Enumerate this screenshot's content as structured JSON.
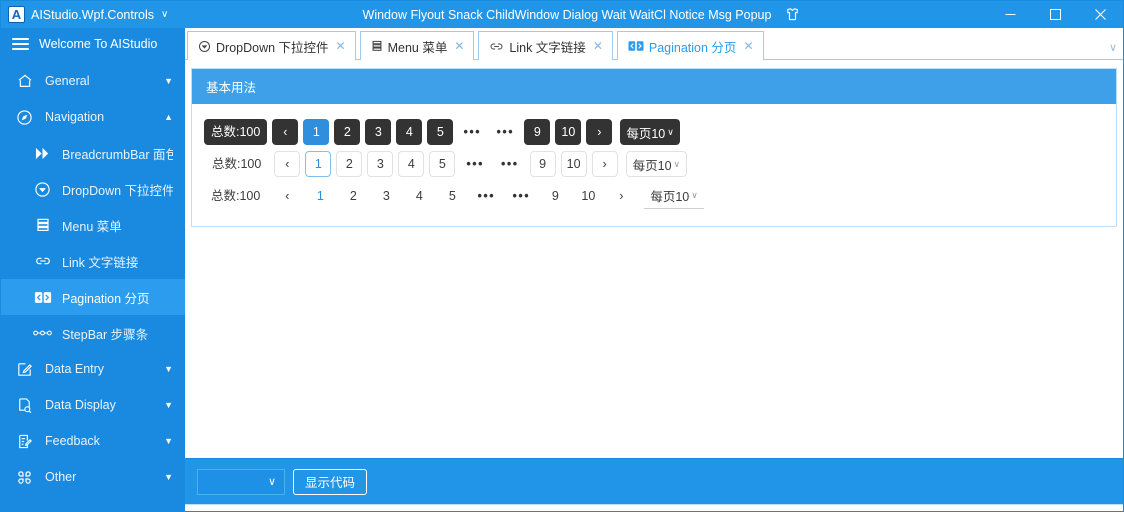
{
  "titlebar": {
    "app_name": "AIStudio.Wpf.Controls",
    "caret": "∨",
    "window_title": "Window Flyout Snack ChildWindow Dialog Wait WaitCl Notice Msg Popup",
    "theme_icon": "shirt-icon",
    "minimize": "—",
    "maximize": "☐",
    "close": "✕",
    "logo_letter": "A",
    "accent_color": "#2196e8"
  },
  "sidebar": {
    "header": "Welcome To AIStudio",
    "items": [
      {
        "label": "General",
        "icon": "home-icon",
        "level": "top",
        "expanded": false,
        "arrow": "▼",
        "active": false
      },
      {
        "label": "Navigation",
        "icon": "compass-icon",
        "level": "top",
        "expanded": true,
        "arrow": "▲",
        "active": false
      },
      {
        "label": "BreadcrumbBar 面包",
        "icon": "double-chevron-icon",
        "level": "child",
        "active": false
      },
      {
        "label": "DropDown 下拉控件",
        "icon": "dropdown-circle-icon",
        "level": "child",
        "active": false
      },
      {
        "label": "Menu 菜单",
        "icon": "menu-list-icon",
        "level": "child",
        "active": false
      },
      {
        "label": "Link 文字链接",
        "icon": "link-icon",
        "level": "child",
        "active": false
      },
      {
        "label": "Pagination 分页",
        "icon": "pagination-icon",
        "level": "child",
        "active": true
      },
      {
        "label": "StepBar 步骤条",
        "icon": "stepbar-icon",
        "level": "child",
        "active": false
      },
      {
        "label": "Data Entry",
        "icon": "edit-icon",
        "level": "top",
        "expanded": false,
        "arrow": "▼",
        "active": false
      },
      {
        "label": "Data Display",
        "icon": "document-search-icon",
        "level": "top",
        "expanded": false,
        "arrow": "▼",
        "active": false
      },
      {
        "label": "Feedback",
        "icon": "clipboard-edit-icon",
        "level": "top",
        "expanded": false,
        "arrow": "▼",
        "active": false
      },
      {
        "label": "Other",
        "icon": "grid-icon",
        "level": "top",
        "expanded": false,
        "arrow": "▼",
        "active": false
      }
    ]
  },
  "tabs": {
    "items": [
      {
        "label": "DropDown 下拉控件",
        "icon": "dropdown-circle-icon",
        "active": false,
        "close": "✕"
      },
      {
        "label": "Menu 菜单",
        "icon": "menu-list-icon",
        "active": false,
        "close": "✕"
      },
      {
        "label": "Link 文字链接",
        "icon": "link-icon",
        "active": false,
        "close": "✕"
      },
      {
        "label": "Pagination 分页",
        "icon": "pagination-icon",
        "active": true,
        "close": "✕"
      }
    ],
    "overflow_caret": "∨"
  },
  "demo": {
    "header": "基本用法",
    "pagers": [
      {
        "style": "filled",
        "total_label": "总数:100",
        "prev": "‹",
        "next": "›",
        "pages": [
          "1",
          "2",
          "3",
          "4",
          "5"
        ],
        "ellipsis_left": "•••",
        "ellipsis_right": "•••",
        "tail_pages": [
          "9",
          "10"
        ],
        "current": "1",
        "page_size_label": "每页10",
        "page_size_caret": "∨"
      },
      {
        "style": "outline",
        "total_label": "总数:100",
        "prev": "‹",
        "next": "›",
        "pages": [
          "1",
          "2",
          "3",
          "4",
          "5"
        ],
        "ellipsis_left": "•••",
        "ellipsis_right": "•••",
        "tail_pages": [
          "9",
          "10"
        ],
        "current": "1",
        "page_size_label": "每页10",
        "page_size_caret": "∨"
      },
      {
        "style": "flat",
        "total_label": "总数:100",
        "prev": "‹",
        "next": "›",
        "pages": [
          "1",
          "2",
          "3",
          "4",
          "5"
        ],
        "ellipsis_left": "•••",
        "ellipsis_right": "•••",
        "tail_pages": [
          "9",
          "10"
        ],
        "current": "1",
        "page_size_label": "每页10",
        "page_size_caret": "∨"
      }
    ]
  },
  "footer": {
    "combo_value": "",
    "combo_caret": "∨",
    "show_code_label": "显示代码"
  },
  "colors": {
    "accent": "#2196e8",
    "sidebar": "#1a8ae0",
    "active_page": "#2f8fdd",
    "dark_button": "#333333",
    "panel_header": "#3da0e8"
  }
}
